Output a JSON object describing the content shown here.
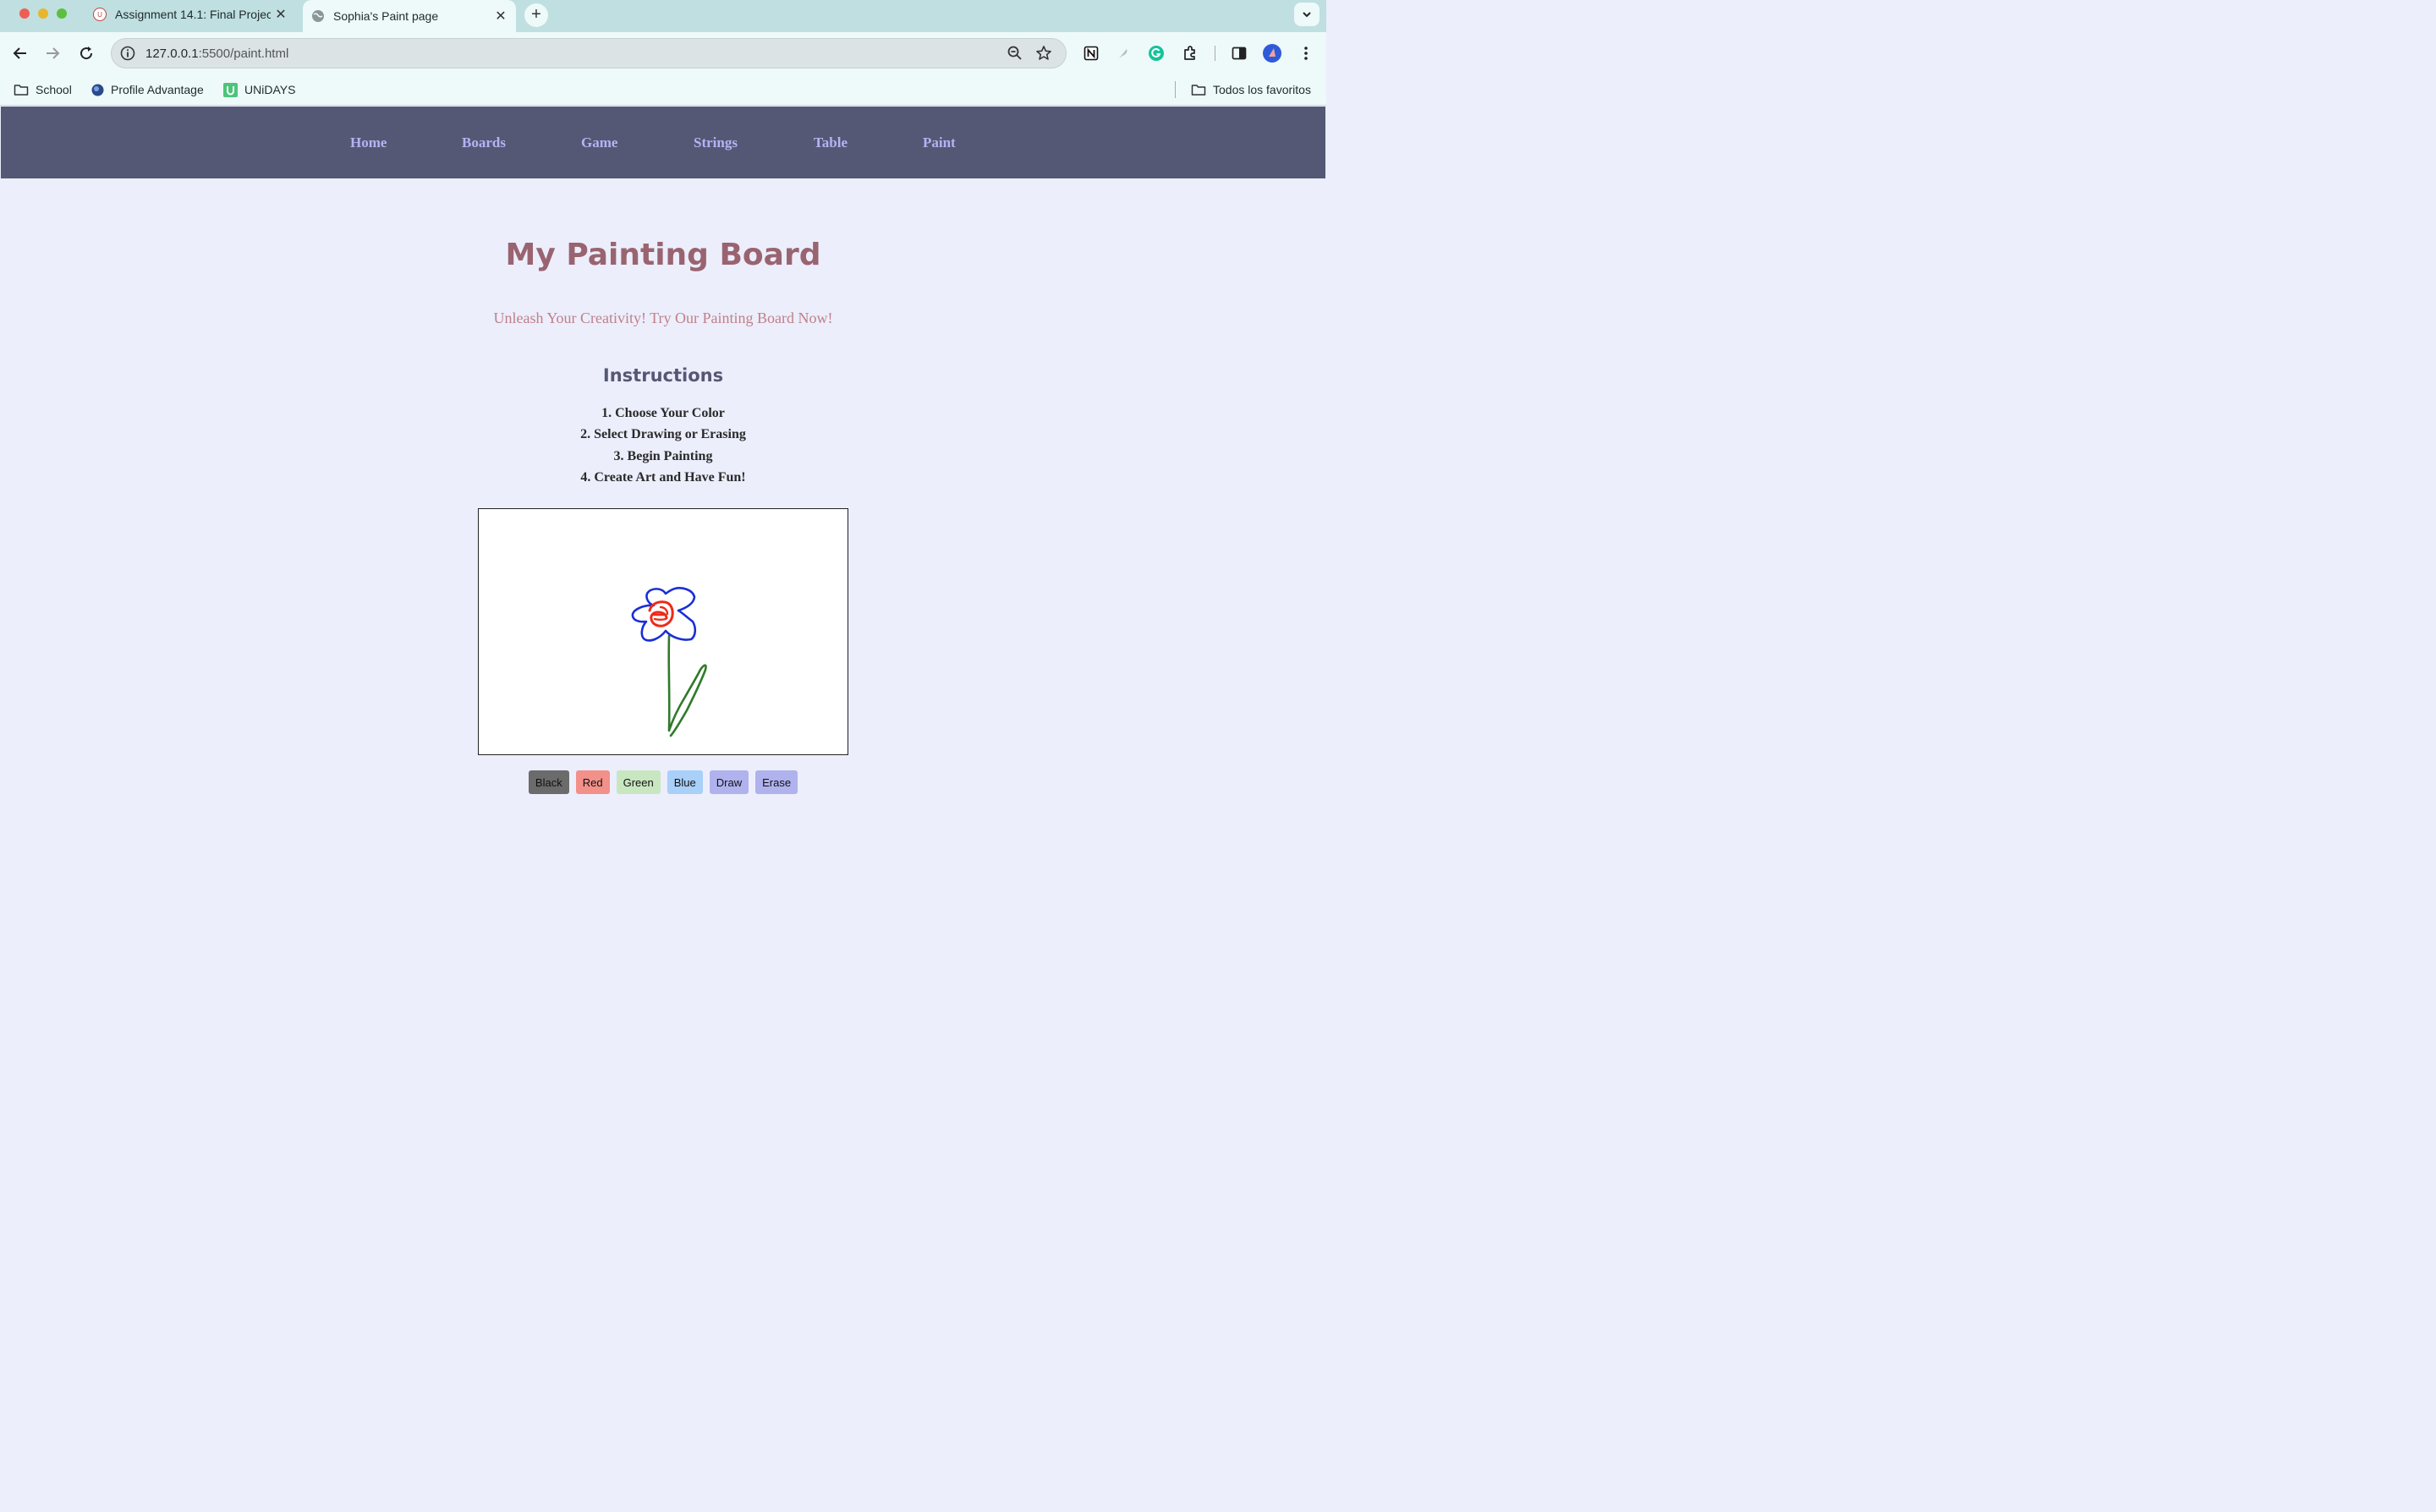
{
  "browser": {
    "tabs": [
      {
        "title": "Assignment 14.1: Final Project",
        "active": false
      },
      {
        "title": "Sophia's Paint page",
        "active": true
      }
    ],
    "address": {
      "host": "127.0.0.1",
      "path": ":5500/paint.html"
    },
    "bookmarks": [
      "School",
      "Profile Advantage",
      "UNiDAYS"
    ],
    "all_bookmarks": "Todos los favoritos",
    "extension_icons": [
      "notion-icon",
      "feather-icon",
      "grammarly-icon",
      "puzzle-icon",
      "sidepanel-icon",
      "profile-avatar",
      "kebab-menu-icon"
    ]
  },
  "nav": {
    "items": [
      "Home",
      "Boards",
      "Game",
      "Strings",
      "Table",
      "Paint"
    ]
  },
  "page": {
    "title": "My Painting Board",
    "tagline": "Unleash Your Creativity! Try Our Painting Board Now!",
    "instructions_heading": "Instructions",
    "steps": [
      "1. Choose Your Color",
      "2. Select Drawing or Erasing",
      "3. Begin Painting",
      "4. Create Art and Have Fun!"
    ]
  },
  "controls": [
    {
      "label": "Black",
      "color": "#6b6b6b"
    },
    {
      "label": "Red",
      "color": "#f2908a"
    },
    {
      "label": "Green",
      "color": "#c8e6c0"
    },
    {
      "label": "Blue",
      "color": "#a8d0f8"
    },
    {
      "label": "Draw",
      "color": "#b0b2ee"
    },
    {
      "label": "Erase",
      "color": "#b0b2ee"
    }
  ],
  "drawing_colors": {
    "petals": "#1a2fd6",
    "center": "#ee2a1a",
    "stem": "#2f7a2a"
  }
}
